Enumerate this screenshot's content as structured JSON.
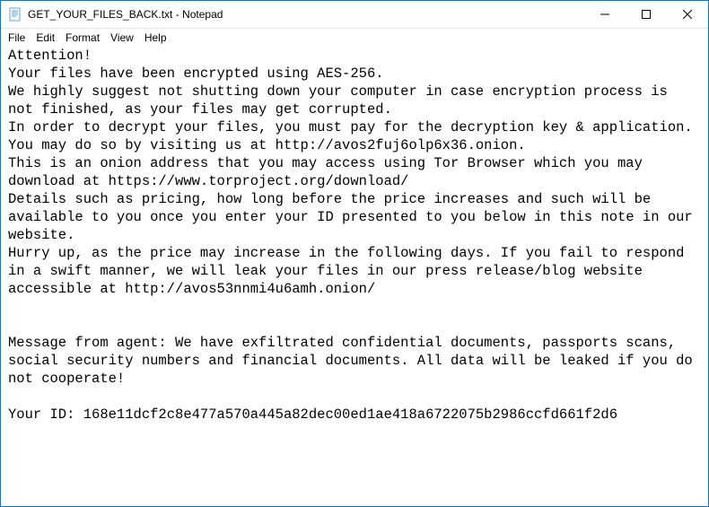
{
  "window": {
    "title": "GET_YOUR_FILES_BACK.txt - Notepad"
  },
  "menu": {
    "file": "File",
    "edit": "Edit",
    "format": "Format",
    "view": "View",
    "help": "Help"
  },
  "document": {
    "body": "Attention!\nYour files have been encrypted using AES-256.\nWe highly suggest not shutting down your computer in case encryption process is not finished, as your files may get corrupted.\nIn order to decrypt your files, you must pay for the decryption key & application.\nYou may do so by visiting us at http://avos2fuj6olp6x36.onion.\nThis is an onion address that you may access using Tor Browser which you may download at https://www.torproject.org/download/\nDetails such as pricing, how long before the price increases and such will be available to you once you enter your ID presented to you below in this note in our website.\nHurry up, as the price may increase in the following days. If you fail to respond in a swift manner, we will leak your files in our press release/blog website accessible at http://avos53nnmi4u6amh.onion/\n\n\nMessage from agent: We have exfiltrated confidential documents, passports scans, social security numbers and financial documents. All data will be leaked if you do not cooperate!\n\nYour ID: 168e11dcf2c8e477a570a445a82dec00ed1ae418a6722075b2986ccfd661f2d6"
  }
}
